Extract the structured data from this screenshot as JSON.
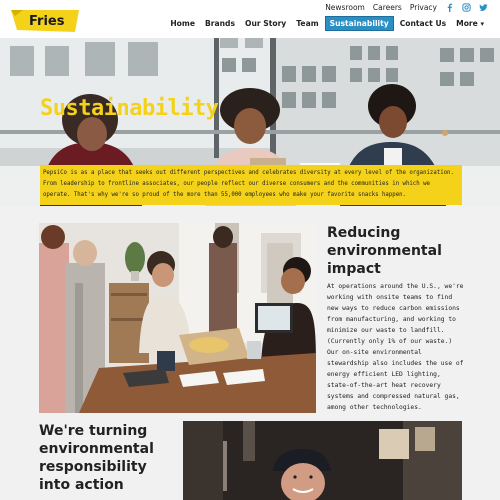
{
  "brand": {
    "logo_text": "Fries"
  },
  "utility_nav": {
    "items": [
      "Newsroom",
      "Careers",
      "Privacy"
    ]
  },
  "social": [
    "facebook-icon",
    "instagram-icon",
    "twitter-icon"
  ],
  "main_nav": {
    "items": [
      "Home",
      "Brands",
      "Our Story",
      "Team",
      "Sustainability",
      "Contact Us",
      "More"
    ],
    "active": "Sustainability"
  },
  "hero": {
    "title": "Sustainability",
    "caption": "PepsiCo is as a place that seeks out different perspectives and celebrates diversity at every level of the organization. From leadership to frontline associates, our people reflect our diverse consumers and the communities in which we operate. That's why we're so proud of the more than 55,000 employees who make your favorite snacks happen."
  },
  "section1": {
    "title": "Reducing environmental impact",
    "body": "At operations around the U.S., we're working with onsite teams to find new ways to reduce carbon emissions from manufacturing, and working to minimize our waste to landfill. (Currently only 1% of our waste.) Our on-site environmental stewardship also includes the use of energy efficient LED lighting, state-of-the-art heat recovery systems and compressed natural gas, among other technologies."
  },
  "section2": {
    "title": "We're turning environmental responsibility into action"
  },
  "colors": {
    "accent": "#f4d21a",
    "nav_active": "#2a8fc5",
    "section_bg": "#f1f1f1"
  }
}
